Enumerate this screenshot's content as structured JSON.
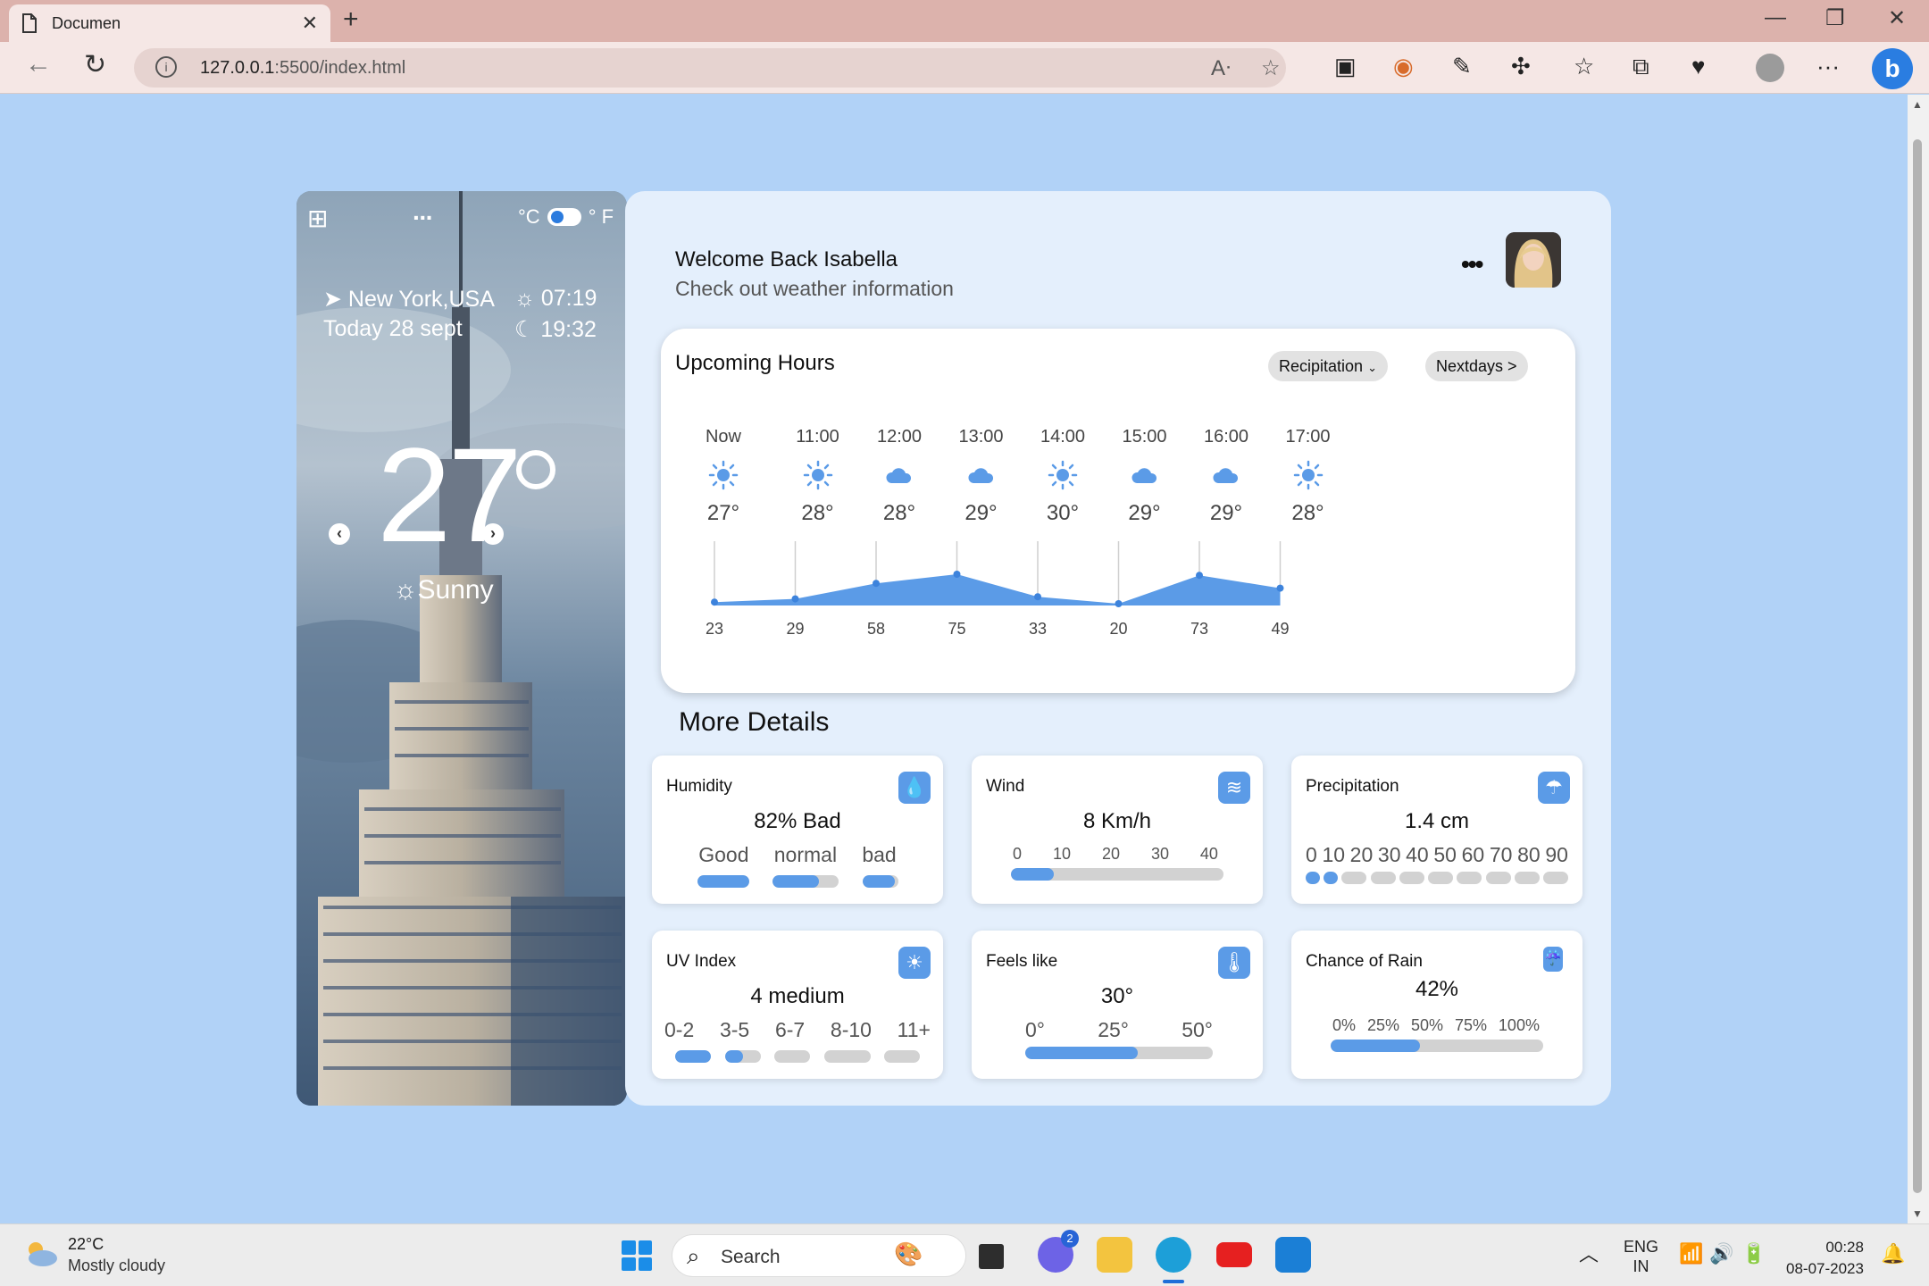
{
  "browser": {
    "tab_title": "Documen",
    "url_host": "127.0.0.1",
    "url_rest": ":5500/index.html"
  },
  "left_card": {
    "unit_c": "°C",
    "unit_f": "° F",
    "location": "New York,USA",
    "date": "Today 28 sept",
    "sunrise": "07:19",
    "sunset": "19:32",
    "temperature": "27",
    "condition": "Sunny"
  },
  "header": {
    "welcome": "Welcome Back Isabella",
    "subtitle": "Check out weather information"
  },
  "upcoming": {
    "title": "Upcoming Hours",
    "filter_label": "Recipitation",
    "next_label": "Nextdays >",
    "hours": [
      {
        "time": "Now",
        "icon": "sun-icon",
        "temp": "27°"
      },
      {
        "time": "11:00",
        "icon": "sun-icon",
        "temp": "28°"
      },
      {
        "time": "12:00",
        "icon": "cloud-icon",
        "temp": "28°"
      },
      {
        "time": "13:00",
        "icon": "cloud-icon",
        "temp": "29°"
      },
      {
        "time": "14:00",
        "icon": "sun-icon",
        "temp": "30°"
      },
      {
        "time": "15:00",
        "icon": "cloud-icon",
        "temp": "29°"
      },
      {
        "time": "16:00",
        "icon": "cloud-icon",
        "temp": "29°"
      },
      {
        "time": "17:00",
        "icon": "sun-icon",
        "temp": "28°"
      }
    ],
    "chart_values": [
      23,
      29,
      58,
      75,
      33,
      20,
      73,
      49
    ]
  },
  "more_details": {
    "title": "More Details",
    "humidity": {
      "label": "Humidity",
      "value": "82% Bad",
      "levels": [
        "Good",
        "normal",
        "bad"
      ],
      "fills": [
        1,
        0.7,
        0.9
      ]
    },
    "wind": {
      "label": "Wind",
      "value": "8 Km/h",
      "ticks": [
        "0",
        "10",
        "20",
        "30",
        "40"
      ],
      "fill": 0.2
    },
    "precipitation": {
      "label": "Precipitation",
      "value": "1.4 cm",
      "ticks": [
        "0",
        "10",
        "20",
        "30",
        "40",
        "50",
        "60",
        "70",
        "80",
        "90"
      ],
      "fills": [
        1,
        1,
        0,
        0,
        0,
        0,
        0,
        0,
        0,
        0
      ]
    },
    "uv": {
      "label": "UV Index",
      "value": "4 medium",
      "levels": [
        "0-2",
        "3-5",
        "6-7",
        "8-10",
        "11+"
      ],
      "fills": [
        1,
        0.5,
        0,
        0,
        0
      ]
    },
    "feels": {
      "label": "Feels like",
      "value": "30°",
      "ticks": [
        "0°",
        "25°",
        "50°"
      ],
      "fill": 0.6
    },
    "rain": {
      "label": "Chance of Rain",
      "value": "42%",
      "ticks": [
        "0%",
        "25%",
        "50%",
        "75%",
        "100%"
      ],
      "fill": 0.42
    }
  },
  "taskbar": {
    "weather_temp": "22°C",
    "weather_cond": "Mostly cloudy",
    "search": "Search",
    "chat_badge": "2",
    "lang": "ENG",
    "region": "IN",
    "time": "00:28",
    "date": "08-07-2023"
  },
  "colors": {
    "accent": "#5b9be7",
    "page_bg": "#b1d2f7",
    "panel_bg": "#e4effc"
  }
}
